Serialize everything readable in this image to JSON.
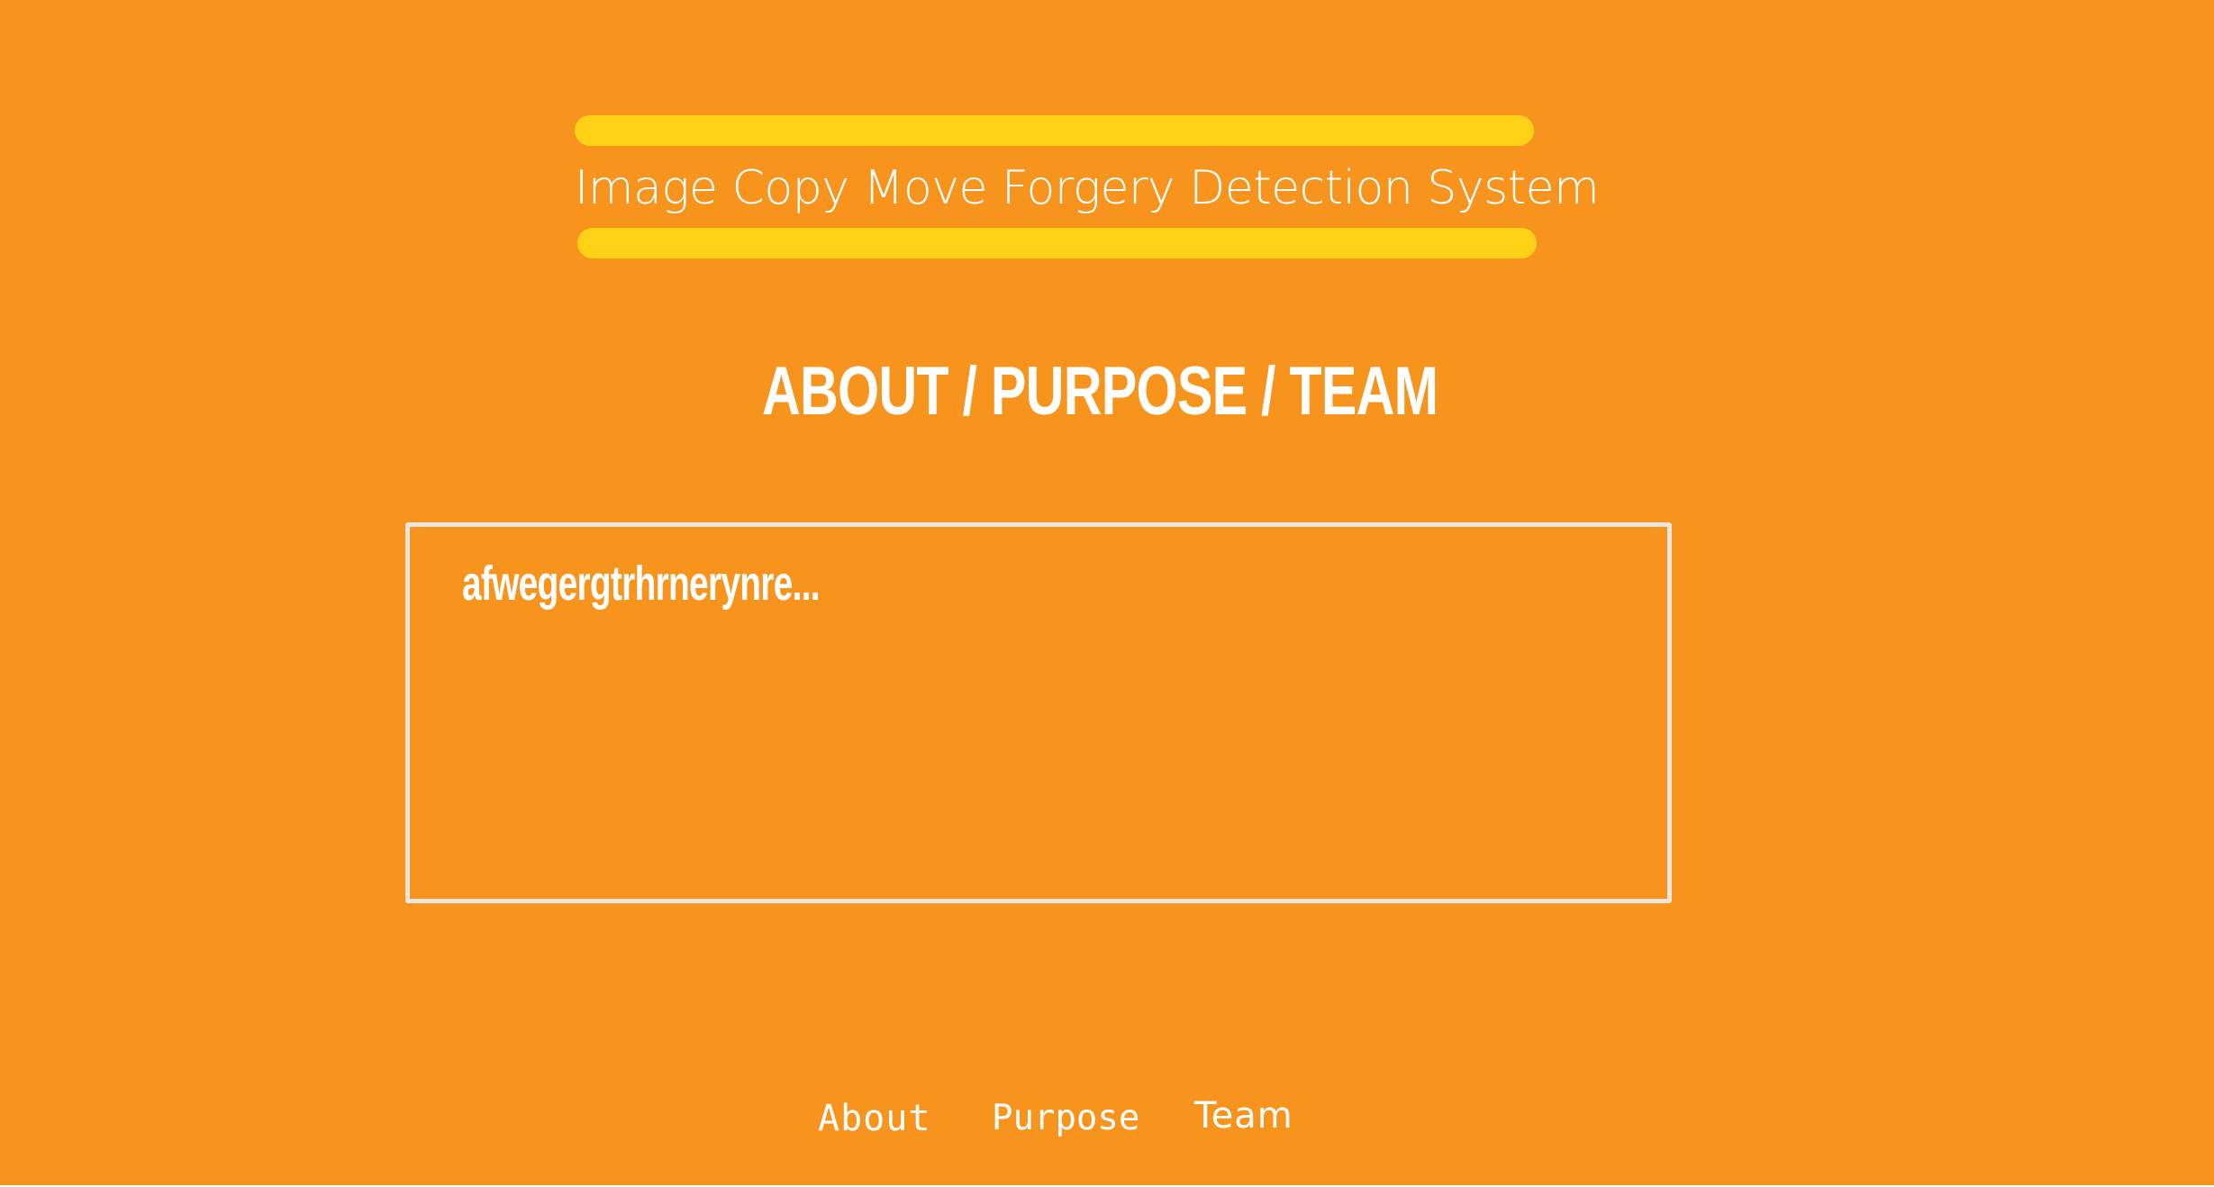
{
  "header": {
    "title": "Image Copy Move Forgery Detection System"
  },
  "main": {
    "heading": "ABOUT / PURPOSE / TEAM",
    "content_text": "afwegergtrhrnerynre..."
  },
  "nav": {
    "items": [
      {
        "label": "About"
      },
      {
        "label": "Purpose"
      },
      {
        "label": "Team"
      }
    ]
  },
  "colors": {
    "background": "#F7941E",
    "accent_bar": "#FCD116",
    "box_border": "#EDE6DC",
    "text": "#FFFFFF"
  }
}
